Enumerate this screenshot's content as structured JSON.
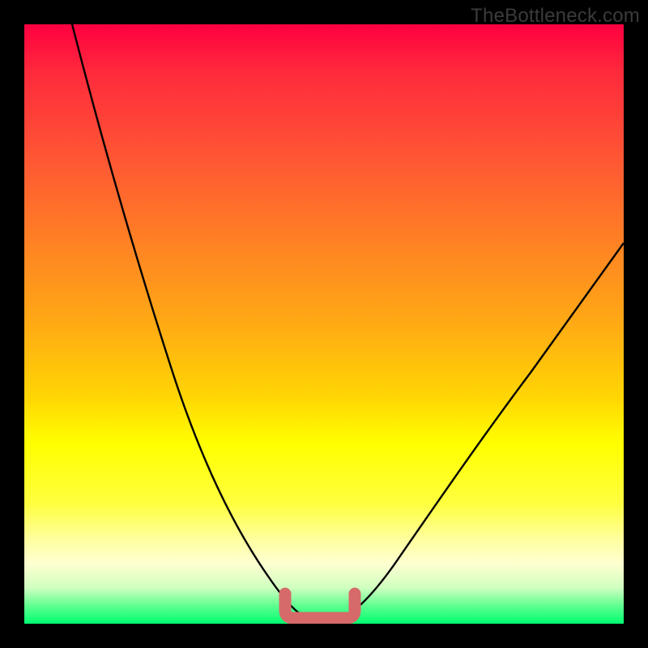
{
  "watermark": {
    "text": "TheBottleneck.com"
  },
  "palette": {
    "curve_stroke": "#000000",
    "bottom_marker": "#d66a6a",
    "background": "#000000"
  },
  "chart_data": {
    "type": "line",
    "title": "",
    "xlabel": "",
    "ylabel": "",
    "xlim": [
      0,
      100
    ],
    "ylim": [
      0,
      100
    ],
    "series": [
      {
        "name": "bottleneck-curve",
        "x": [
          8,
          12,
          16,
          20,
          24,
          28,
          32,
          36,
          38,
          40,
          42,
          44,
          46,
          48,
          50,
          54,
          58,
          62,
          66,
          70,
          76,
          82,
          88,
          94,
          100
        ],
        "y": [
          100,
          86,
          72,
          59,
          47,
          36,
          26,
          16,
          11,
          7,
          4,
          2,
          1,
          0,
          0,
          1,
          3,
          7,
          12,
          18,
          26,
          34,
          42,
          49,
          55
        ]
      }
    ],
    "annotations": [
      {
        "name": "optimal-plateau",
        "shape": "u-marker",
        "x_range": [
          43,
          53
        ],
        "y": 0,
        "color": "#d66a6a"
      }
    ]
  }
}
